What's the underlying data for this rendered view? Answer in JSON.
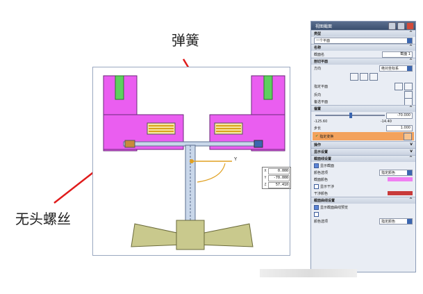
{
  "annotations": {
    "spring": "弹簧",
    "setscrew": "无头螺丝"
  },
  "colors": {
    "part": "#ea5ef0",
    "part_outline": "#6a2a7a",
    "spring_gold": "#d8a51a",
    "shaft": "#c9d7ea",
    "hub": "#c9c98d",
    "arrow_red": "#e01b1b",
    "panel_accent": "#f3a25c",
    "plane_color": "#f07ff2",
    "cross_color": "#c83a3a"
  },
  "viewport": {
    "coord_labels": [
      "X",
      "Y",
      "Z"
    ],
    "coords": [
      "0.000",
      "-70.000",
      "57.410"
    ],
    "axis_label": "Y"
  },
  "panel": {
    "title": "视图截面",
    "sections": {
      "type": "类型",
      "name": "名称",
      "cut_plane": "剖切平面",
      "offset": "偏置",
      "ops": "操作",
      "display": "显示设置",
      "section_settings": "截面线设置",
      "curve_settings": "截面曲线设置"
    },
    "type_value": "一个平面",
    "name_label": "截面名",
    "name_value": "截面 1",
    "direction_label": "方向",
    "direction_value": "绝对坐标系",
    "specify_plane": "指定平面",
    "reverse": "反向",
    "alt_plane": "备选平面",
    "offset_value": "-70.000",
    "range_min": "-125.60",
    "range_max": "-14.40",
    "step_label": "步长",
    "step_value": "1.000",
    "specify_transform": "指定变换",
    "show_section": "显示截面",
    "color_option_label": "颜色选项",
    "color_option_value": "指定颜色",
    "section_color": "截面颜色",
    "show_interference": "显示干涉",
    "interference_color": "干涉颜色",
    "show_curve": "显示截面曲线预览",
    "dynamic_update": "",
    "color_option2_label": "颜色选项",
    "color_option2_value": "指定颜色"
  }
}
